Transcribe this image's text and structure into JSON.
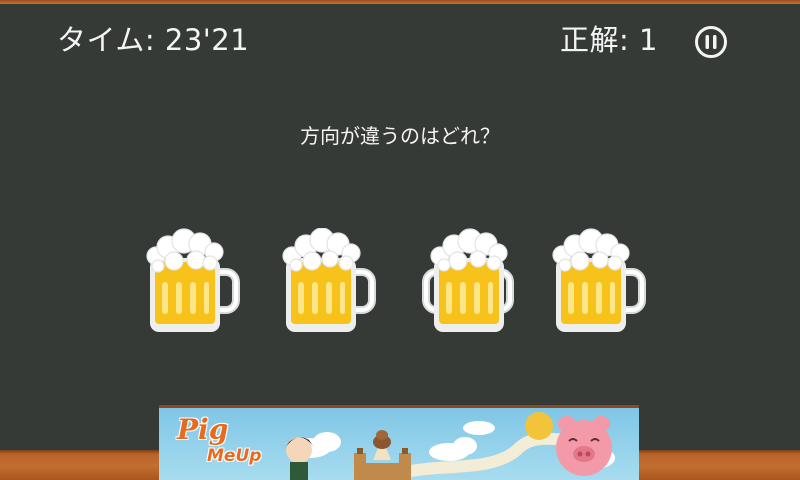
{
  "hud": {
    "time_label": "タイム: 23'21",
    "score_label": "正解: 1"
  },
  "question": "方向が違うのはどれ？",
  "mugs": [
    {
      "id": 1,
      "handle": "right"
    },
    {
      "id": 2,
      "handle": "right"
    },
    {
      "id": 3,
      "handle": "both"
    },
    {
      "id": 4,
      "handle": "right"
    }
  ],
  "ad": {
    "title": "Pig",
    "subtitle": "MeUp"
  },
  "colors": {
    "board": "#363a37",
    "frame": "#b8632a",
    "beer": "#f7c21a",
    "foam": "#ffffff"
  }
}
